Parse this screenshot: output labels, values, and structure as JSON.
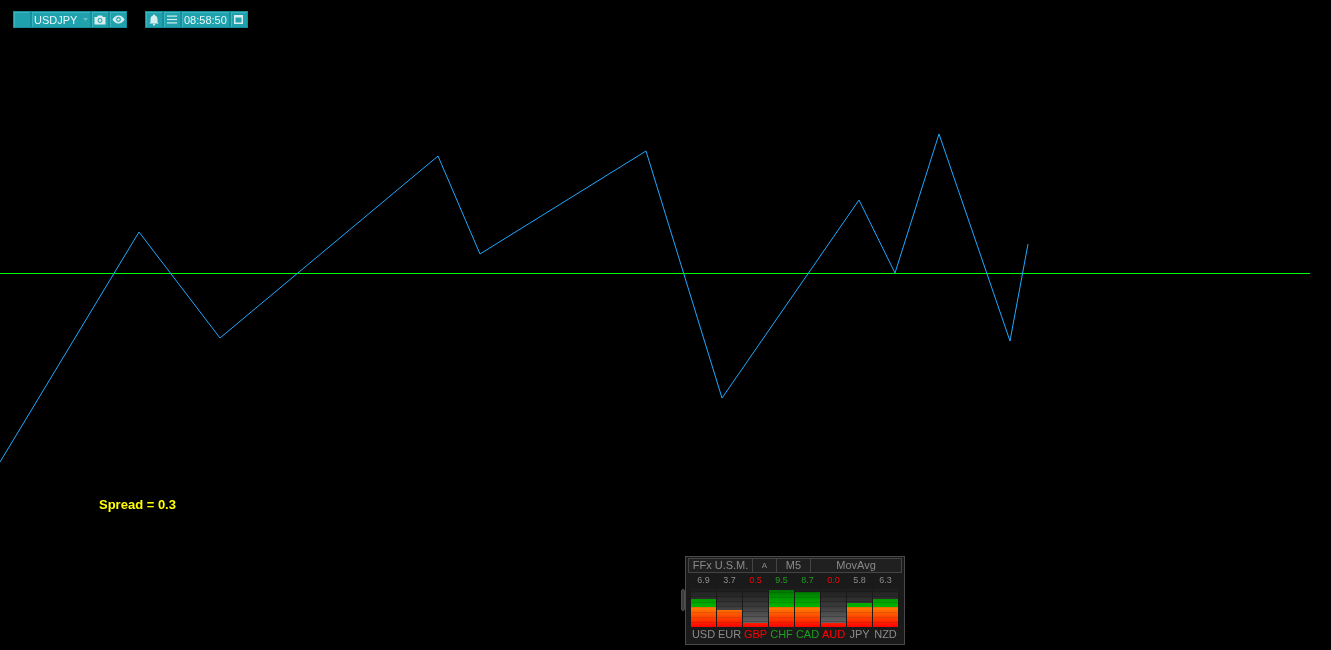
{
  "toolbar": {
    "symbol": "USDJPY",
    "time": "08:58:50"
  },
  "spread": "Spread = 0.3",
  "meter": {
    "title": "FFx U.S.M.",
    "mode": "A",
    "timeframe": "M5",
    "method": "MovAvg",
    "currencies": [
      {
        "code": "USD",
        "value": "6.9",
        "level": 0.7,
        "color": "#8c8c8c"
      },
      {
        "code": "EUR",
        "value": "3.7",
        "level": 0.42,
        "color": "#8c8c8c"
      },
      {
        "code": "GBP",
        "value": "0.5",
        "level": 0.1,
        "color": "#ff0000"
      },
      {
        "code": "CHF",
        "value": "9.5",
        "level": 0.92,
        "color": "#1e9e1e"
      },
      {
        "code": "CAD",
        "value": "8.7",
        "level": 0.88,
        "color": "#1e9e1e"
      },
      {
        "code": "AUD",
        "value": "0.0",
        "level": 0.1,
        "color": "#ff0000"
      },
      {
        "code": "JPY",
        "value": "5.8",
        "level": 0.6,
        "color": "#8c8c8c"
      },
      {
        "code": "NZD",
        "value": "6.3",
        "level": 0.7,
        "color": "#8c8c8c"
      }
    ]
  }
}
